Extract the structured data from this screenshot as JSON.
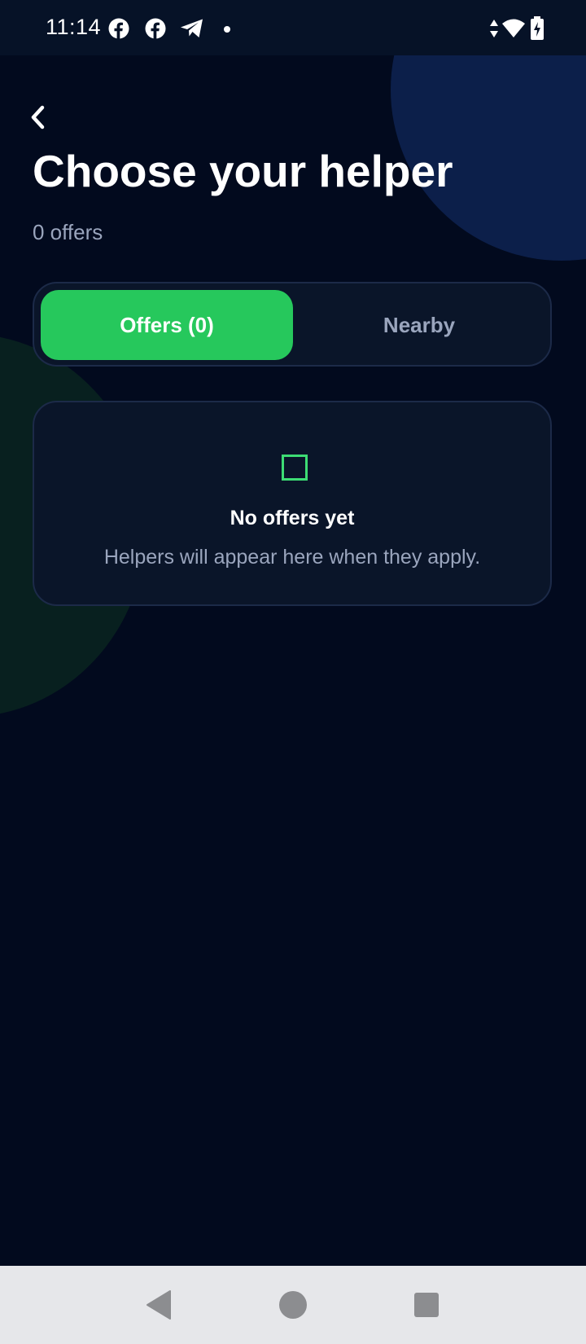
{
  "status_bar": {
    "time": "11:14",
    "left_icons": [
      "facebook-icon",
      "facebook-icon",
      "telegram-icon",
      "notification-dot"
    ],
    "right_icons": [
      "data-arrows-icon",
      "wifi-icon",
      "battery-charging-icon"
    ]
  },
  "header": {
    "back_label": "‹",
    "title": "Choose your helper",
    "subtitle": "0 offers"
  },
  "tabs": [
    {
      "label": "Offers (0)",
      "selected": true
    },
    {
      "label": "Nearby",
      "selected": false
    }
  ],
  "empty_state": {
    "icon": "square-outline-icon",
    "title": "No offers yet",
    "message": "Helpers will appear here when they apply."
  },
  "nav_bar": {
    "buttons": [
      "back-triangle-icon",
      "home-circle-icon",
      "recents-square-icon"
    ]
  },
  "colors": {
    "background": "#020a1e",
    "accent_green": "#26c85c",
    "card": "#0a1529",
    "muted_text": "#9aa5bd",
    "blob_blue": "#0c1f4a",
    "blob_green": "#08201f"
  }
}
